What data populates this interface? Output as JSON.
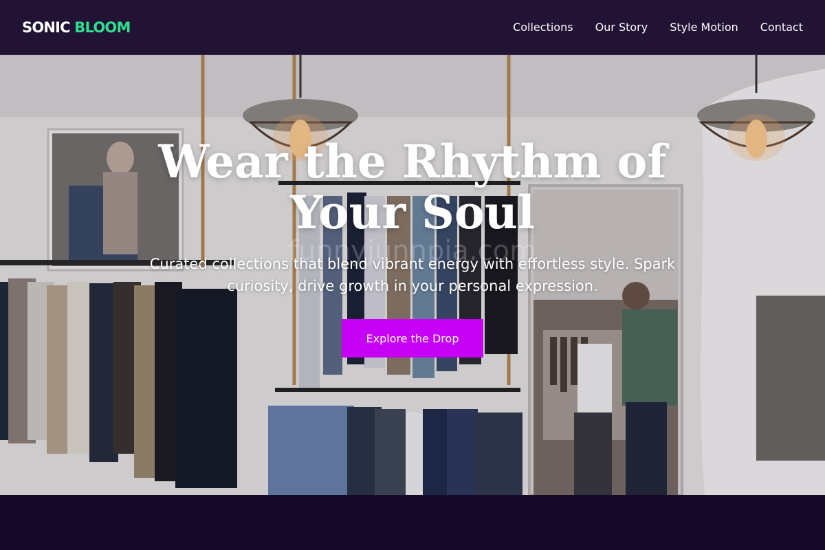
{
  "header": {
    "brand_part1": "SONIC",
    "brand_part2": "BLOOM",
    "nav": [
      "Collections",
      "Our Story",
      "Style Motion",
      "Contact"
    ]
  },
  "hero": {
    "title": "Wear the Rhythm of Your Soul",
    "subtitle": "Curated collections that blend vibrant energy with effortless style. Spark curiosity, drive growth in your personal expression.",
    "cta_label": "Explore the Drop",
    "watermark": "funnyjunnpia.com"
  },
  "colors": {
    "header_bg": "#221234",
    "brand_accent": "#2fe08f",
    "cta_bg": "#c600f5",
    "page_bg": "#170a2b"
  }
}
